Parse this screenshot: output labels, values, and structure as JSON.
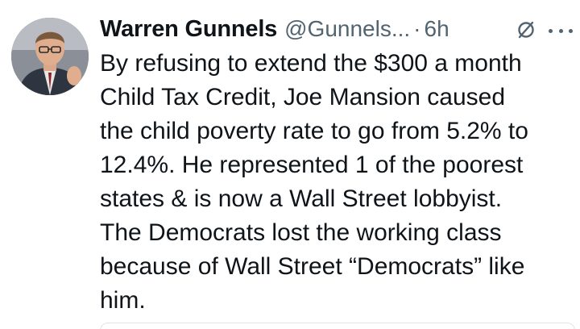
{
  "tweet": {
    "author": {
      "display_name": "Warren Gunnels",
      "handle": "@Gunnels...",
      "avatar_icon": "avatar-photo"
    },
    "separator": "·",
    "timestamp": "6h",
    "actions": {
      "grok_icon": "grok-slash-circle-icon",
      "more_icon": "more-options-icon"
    },
    "text_lines": [
      "By refusing to extend the $300 a month",
      "Child Tax Credit, Joe Mansion caused",
      "the child poverty rate to go from 5.2% to",
      "12.4%. He represented 1 of the poorest",
      "states & is now a Wall Street lobbyist.",
      "The Democrats lost the working class",
      "because of Wall Street “Democrats” like",
      "him."
    ]
  },
  "colors": {
    "text_primary": "#0f1419",
    "text_secondary": "#536471",
    "background": "#ffffff",
    "card_border": "#dfe4e8"
  }
}
